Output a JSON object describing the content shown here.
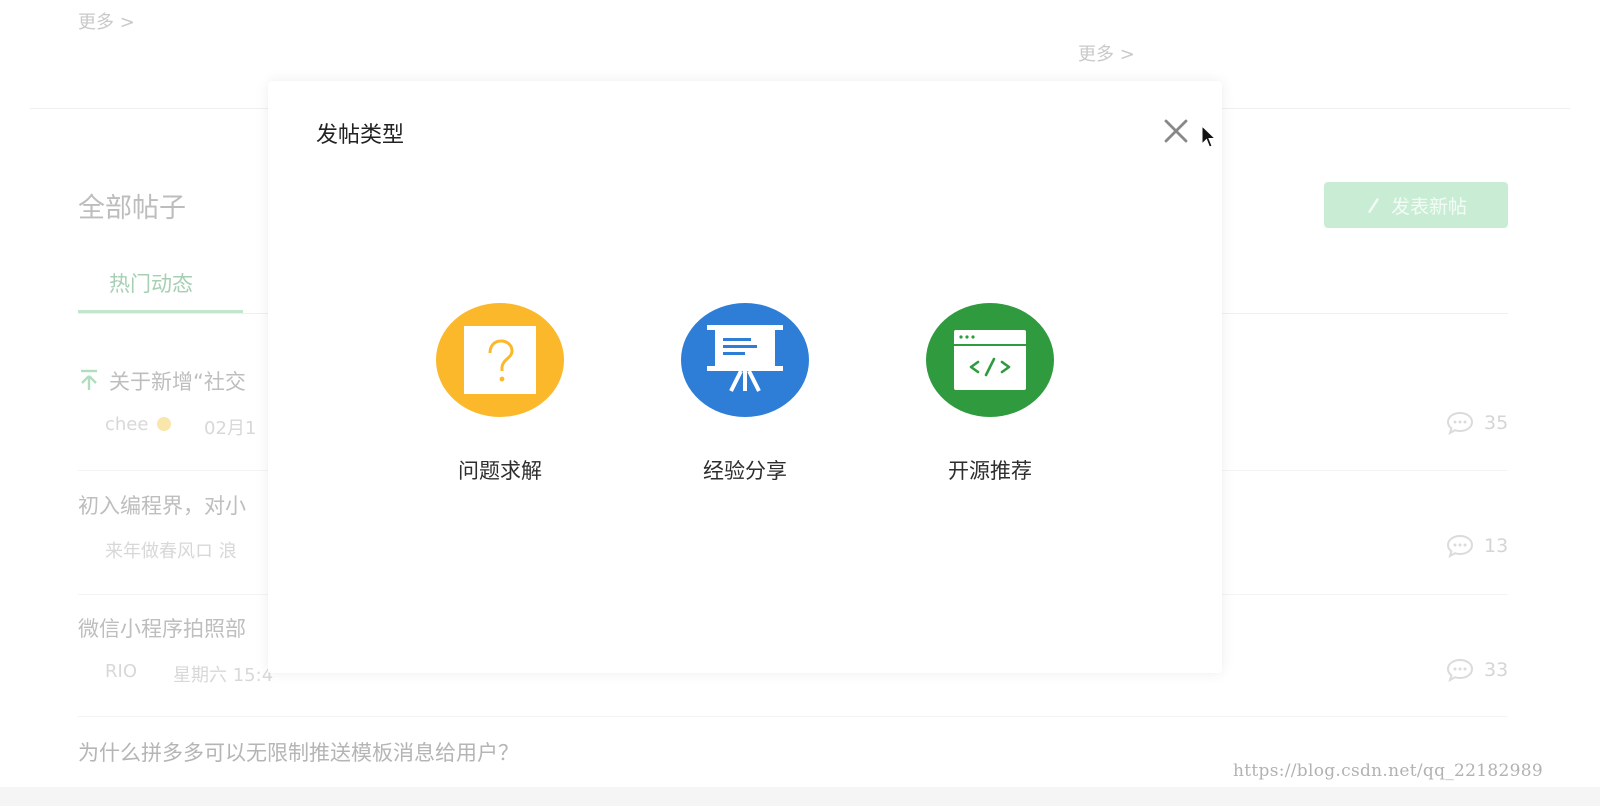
{
  "background": {
    "more_left": "更多 >",
    "more_right": "更多 >",
    "section_title": "全部帖子",
    "new_post_button": "发表新帖",
    "tabs": [
      {
        "label": "热门动态",
        "active": true
      }
    ],
    "posts": [
      {
        "title": "关于新增“社交",
        "author": "chee",
        "time": "02月1",
        "comments": "35",
        "pinned": true
      },
      {
        "title": "初入编程界，对小",
        "author": "来年做春风ロ 浪",
        "time": "",
        "comments": "13",
        "pinned": false
      },
      {
        "title": "微信小程序拍照部",
        "author": "RIO",
        "time": "星期六 15:4",
        "comments": "33",
        "pinned": false
      },
      {
        "title": "为什么拼多多可以无限制推送模板消息给用户？",
        "author": "",
        "time": "",
        "comments": "",
        "pinned": false
      }
    ],
    "watermark": "https://blog.csdn.net/qq_22182989"
  },
  "modal": {
    "title": "发帖类型",
    "types": [
      {
        "label": "问题求解",
        "icon": "question-board-icon",
        "color": "#fbb82b"
      },
      {
        "label": "经验分享",
        "icon": "presentation-icon",
        "color": "#2e7ed8"
      },
      {
        "label": "开源推荐",
        "icon": "code-window-icon",
        "color": "#2f9b3e"
      }
    ]
  },
  "colors": {
    "accent_green": "#c2ebcf",
    "tab_active_green": "#9ac9aa"
  }
}
